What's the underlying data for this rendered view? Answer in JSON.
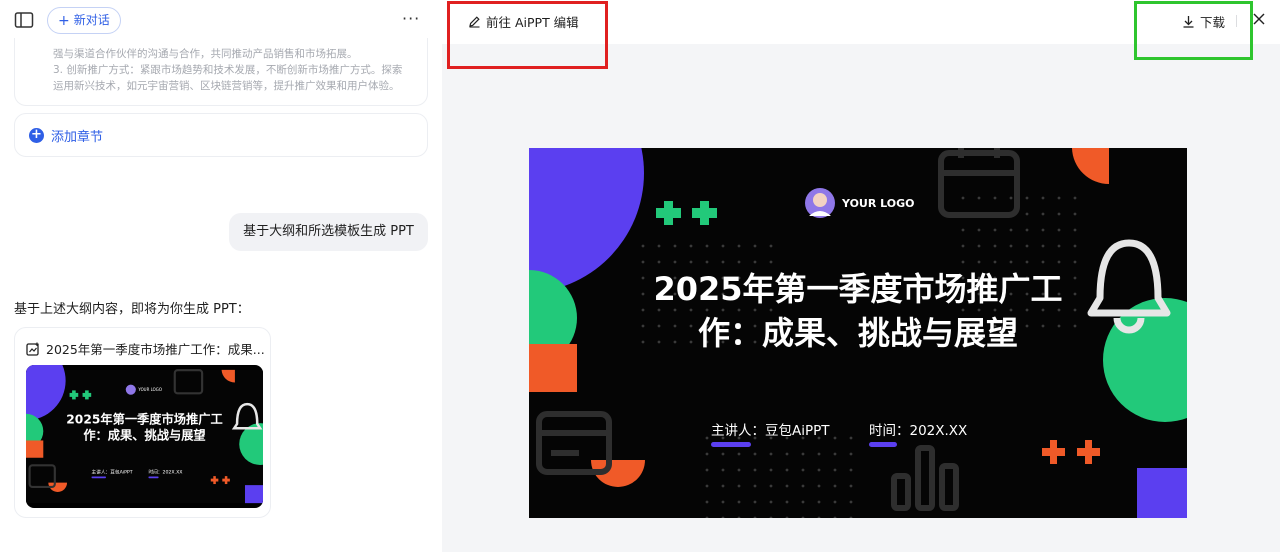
{
  "header": {
    "new_chat_label": "新对话"
  },
  "outline": {
    "lines": [
      "强与渠道合作伙伴的沟通与合作，共同推动产品销售和市场拓展。",
      "3. 创新推广方式：紧跟市场趋势和技术发展，不断创新市场推广方式。探索",
      "运用新兴技术，如元宇宙营销、区块链营销等，提升推广效果和用户体验。"
    ]
  },
  "add_chapter_label": "添加章节",
  "user_message": "基于大纲和所选模板生成 PPT",
  "bot_message": "基于上述大纲内容，即将为你生成 PPT：",
  "ppt_card": {
    "title": "2025年第一季度市场推广工作：成果..."
  },
  "preview": {
    "edit_label": "前往 AiPPT 编辑",
    "download_label": "下载"
  },
  "slide": {
    "logo_text": "YOUR LOGO",
    "title_line1": "2025年第一季度市场推广工",
    "title_line2": "作：成果、挑战与展望",
    "presenter": "主讲人：豆包AiPPT",
    "time": "时间：202X.XX"
  },
  "colors": {
    "accent_blue": "#2f5fe6",
    "slide_purple": "#5b3ff0",
    "slide_green": "#22c97a",
    "slide_orange": "#f05a28",
    "highlight_red": "#e02020",
    "highlight_green": "#2ec52e"
  }
}
